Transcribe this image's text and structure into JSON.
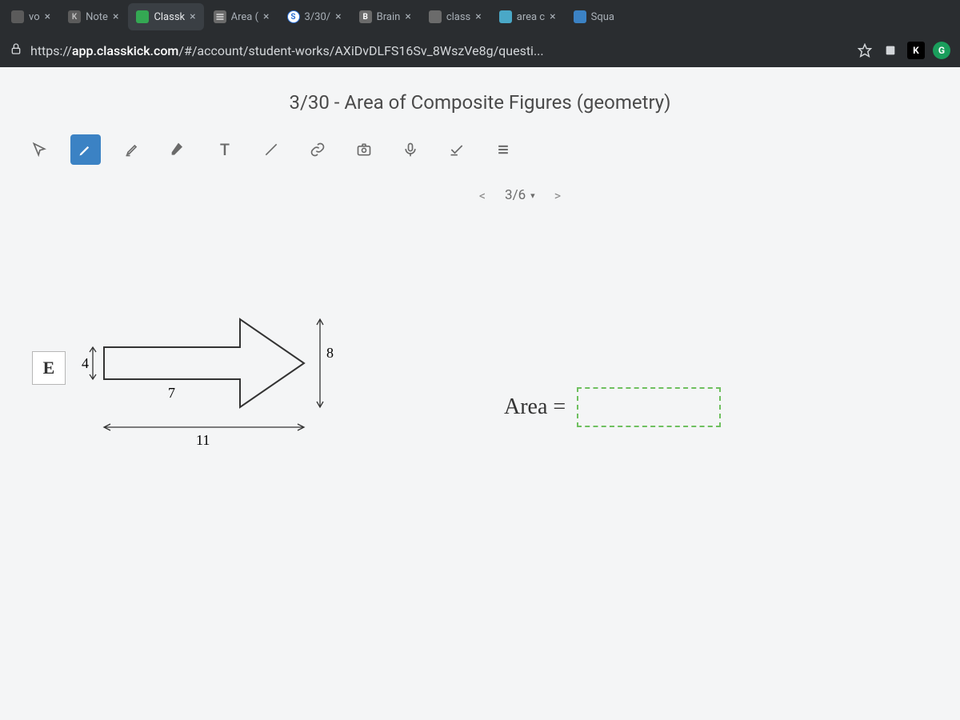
{
  "tabs": [
    {
      "title": "vo",
      "favicon_bg": "#5b5b5b",
      "favicon_text": ""
    },
    {
      "title": "Note",
      "favicon_bg": "#5b5b5b",
      "favicon_text": "K"
    },
    {
      "title": "Classk",
      "favicon_bg": "#34a853",
      "favicon_text": "",
      "active": true
    },
    {
      "title": "Area (",
      "favicon_bg": "#6b6b6b",
      "favicon_text": ""
    },
    {
      "title": "3/30/",
      "favicon_bg": "#2a6fd6",
      "favicon_text": "S"
    },
    {
      "title": "Brain",
      "favicon_bg": "#6b6b6b",
      "favicon_text": "B"
    },
    {
      "title": "class",
      "favicon_bg": "#6b6b6b",
      "favicon_text": ""
    },
    {
      "title": "area c",
      "favicon_bg": "#4aa8c7",
      "favicon_text": ""
    },
    {
      "title": "Squa",
      "favicon_bg": "#3b82c4",
      "favicon_text": ""
    }
  ],
  "url": {
    "protocol": "https://",
    "host": "app.classkick.com",
    "path": "/#/account/student-works/AXiDvDLFS16Sv_8WszVe8g/questi..."
  },
  "page_title": "3/30 - Area of Composite Figures (geometry)",
  "nav": {
    "prev": "<",
    "label": "3/6",
    "dd": "▾",
    "next": ">"
  },
  "toolbar": {
    "cursor": "",
    "pen": "",
    "highlighter": "",
    "eraser": "",
    "fill": "",
    "text": "T",
    "line": "",
    "link": "",
    "camera": "",
    "mic": "",
    "check": "",
    "list": ""
  },
  "problem": {
    "letter": "E",
    "dim_left": "4",
    "dim_bottom_inner": "7",
    "dim_bottom_total": "11",
    "dim_right": "8",
    "area_label": "Area ="
  }
}
